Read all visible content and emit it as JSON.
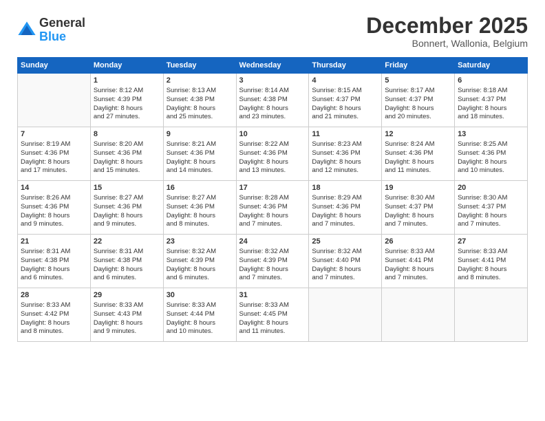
{
  "logo": {
    "general": "General",
    "blue": "Blue"
  },
  "title": {
    "month_year": "December 2025",
    "location": "Bonnert, Wallonia, Belgium"
  },
  "days_of_week": [
    "Sunday",
    "Monday",
    "Tuesday",
    "Wednesday",
    "Thursday",
    "Friday",
    "Saturday"
  ],
  "weeks": [
    [
      {
        "day": "",
        "content": ""
      },
      {
        "day": "1",
        "content": "Sunrise: 8:12 AM\nSunset: 4:39 PM\nDaylight: 8 hours\nand 27 minutes."
      },
      {
        "day": "2",
        "content": "Sunrise: 8:13 AM\nSunset: 4:38 PM\nDaylight: 8 hours\nand 25 minutes."
      },
      {
        "day": "3",
        "content": "Sunrise: 8:14 AM\nSunset: 4:38 PM\nDaylight: 8 hours\nand 23 minutes."
      },
      {
        "day": "4",
        "content": "Sunrise: 8:15 AM\nSunset: 4:37 PM\nDaylight: 8 hours\nand 21 minutes."
      },
      {
        "day": "5",
        "content": "Sunrise: 8:17 AM\nSunset: 4:37 PM\nDaylight: 8 hours\nand 20 minutes."
      },
      {
        "day": "6",
        "content": "Sunrise: 8:18 AM\nSunset: 4:37 PM\nDaylight: 8 hours\nand 18 minutes."
      }
    ],
    [
      {
        "day": "7",
        "content": "Sunrise: 8:19 AM\nSunset: 4:36 PM\nDaylight: 8 hours\nand 17 minutes."
      },
      {
        "day": "8",
        "content": "Sunrise: 8:20 AM\nSunset: 4:36 PM\nDaylight: 8 hours\nand 15 minutes."
      },
      {
        "day": "9",
        "content": "Sunrise: 8:21 AM\nSunset: 4:36 PM\nDaylight: 8 hours\nand 14 minutes."
      },
      {
        "day": "10",
        "content": "Sunrise: 8:22 AM\nSunset: 4:36 PM\nDaylight: 8 hours\nand 13 minutes."
      },
      {
        "day": "11",
        "content": "Sunrise: 8:23 AM\nSunset: 4:36 PM\nDaylight: 8 hours\nand 12 minutes."
      },
      {
        "day": "12",
        "content": "Sunrise: 8:24 AM\nSunset: 4:36 PM\nDaylight: 8 hours\nand 11 minutes."
      },
      {
        "day": "13",
        "content": "Sunrise: 8:25 AM\nSunset: 4:36 PM\nDaylight: 8 hours\nand 10 minutes."
      }
    ],
    [
      {
        "day": "14",
        "content": "Sunrise: 8:26 AM\nSunset: 4:36 PM\nDaylight: 8 hours\nand 9 minutes."
      },
      {
        "day": "15",
        "content": "Sunrise: 8:27 AM\nSunset: 4:36 PM\nDaylight: 8 hours\nand 9 minutes."
      },
      {
        "day": "16",
        "content": "Sunrise: 8:27 AM\nSunset: 4:36 PM\nDaylight: 8 hours\nand 8 minutes."
      },
      {
        "day": "17",
        "content": "Sunrise: 8:28 AM\nSunset: 4:36 PM\nDaylight: 8 hours\nand 7 minutes."
      },
      {
        "day": "18",
        "content": "Sunrise: 8:29 AM\nSunset: 4:36 PM\nDaylight: 8 hours\nand 7 minutes."
      },
      {
        "day": "19",
        "content": "Sunrise: 8:30 AM\nSunset: 4:37 PM\nDaylight: 8 hours\nand 7 minutes."
      },
      {
        "day": "20",
        "content": "Sunrise: 8:30 AM\nSunset: 4:37 PM\nDaylight: 8 hours\nand 7 minutes."
      }
    ],
    [
      {
        "day": "21",
        "content": "Sunrise: 8:31 AM\nSunset: 4:38 PM\nDaylight: 8 hours\nand 6 minutes."
      },
      {
        "day": "22",
        "content": "Sunrise: 8:31 AM\nSunset: 4:38 PM\nDaylight: 8 hours\nand 6 minutes."
      },
      {
        "day": "23",
        "content": "Sunrise: 8:32 AM\nSunset: 4:39 PM\nDaylight: 8 hours\nand 6 minutes."
      },
      {
        "day": "24",
        "content": "Sunrise: 8:32 AM\nSunset: 4:39 PM\nDaylight: 8 hours\nand 7 minutes."
      },
      {
        "day": "25",
        "content": "Sunrise: 8:32 AM\nSunset: 4:40 PM\nDaylight: 8 hours\nand 7 minutes."
      },
      {
        "day": "26",
        "content": "Sunrise: 8:33 AM\nSunset: 4:41 PM\nDaylight: 8 hours\nand 7 minutes."
      },
      {
        "day": "27",
        "content": "Sunrise: 8:33 AM\nSunset: 4:41 PM\nDaylight: 8 hours\nand 8 minutes."
      }
    ],
    [
      {
        "day": "28",
        "content": "Sunrise: 8:33 AM\nSunset: 4:42 PM\nDaylight: 8 hours\nand 8 minutes."
      },
      {
        "day": "29",
        "content": "Sunrise: 8:33 AM\nSunset: 4:43 PM\nDaylight: 8 hours\nand 9 minutes."
      },
      {
        "day": "30",
        "content": "Sunrise: 8:33 AM\nSunset: 4:44 PM\nDaylight: 8 hours\nand 10 minutes."
      },
      {
        "day": "31",
        "content": "Sunrise: 8:33 AM\nSunset: 4:45 PM\nDaylight: 8 hours\nand 11 minutes."
      },
      {
        "day": "",
        "content": ""
      },
      {
        "day": "",
        "content": ""
      },
      {
        "day": "",
        "content": ""
      }
    ]
  ]
}
